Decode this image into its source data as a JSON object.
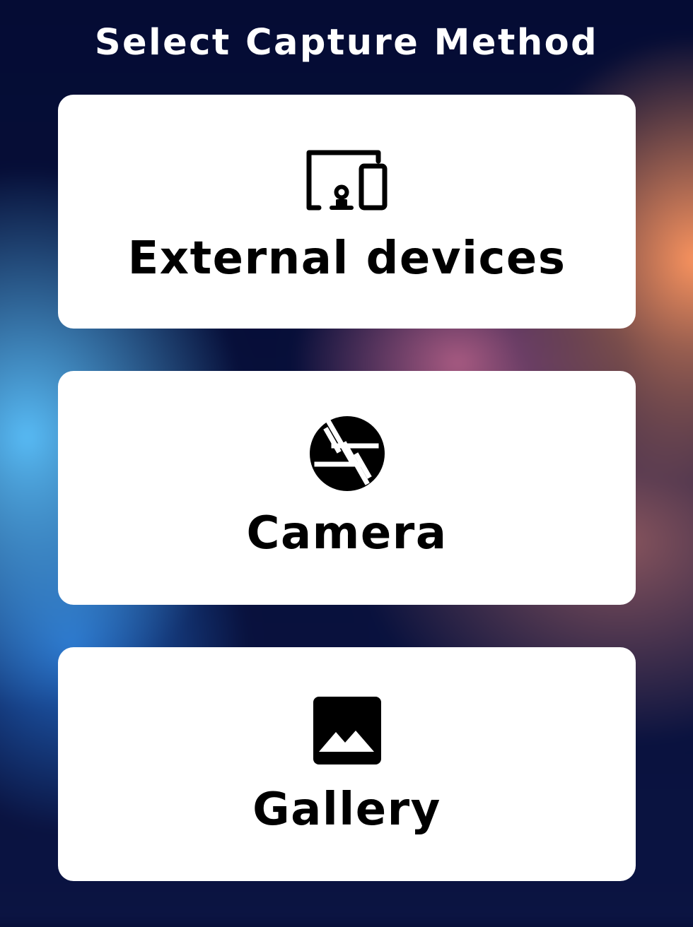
{
  "page": {
    "title": "Select Capture Method"
  },
  "options": [
    {
      "label": "External devices",
      "icon": "devices-icon"
    },
    {
      "label": "Camera",
      "icon": "camera-shutter-icon"
    },
    {
      "label": "Gallery",
      "icon": "image-gallery-icon"
    }
  ],
  "colors": {
    "card_background": "#ffffff",
    "text": "#000000",
    "title_text": "#ffffff",
    "page_background": "#050c34",
    "accent_orange": "#ff965f",
    "accent_blue": "#5cc4ff"
  }
}
